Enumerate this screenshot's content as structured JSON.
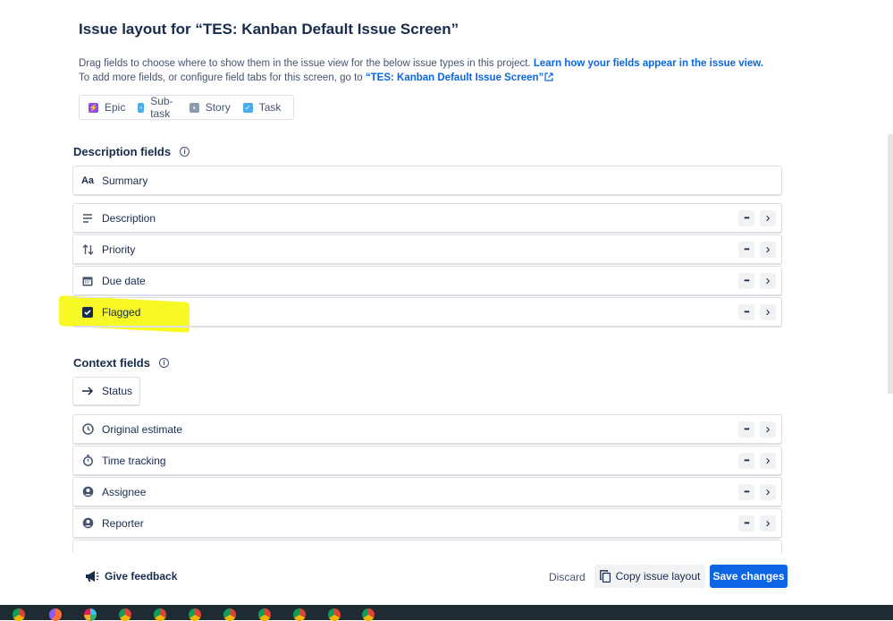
{
  "header": {
    "title": "Issue layout for “TES: Kanban Default Issue Screen”",
    "line1_text": "Drag fields to choose where to show them in the issue view for the below issue types in this project. ",
    "line1_link": "Learn how your fields appear in the issue view.",
    "line2_text": "To add more fields, or configure field tabs for this screen, go to ",
    "line2_link": "“TES: Kanban Default Issue Screen”"
  },
  "issue_types": [
    {
      "label": "Epic",
      "icon": "epic-icon",
      "color": "#904ee2"
    },
    {
      "label": "Sub-task",
      "icon": "subtask-icon",
      "color": "#4bade8"
    },
    {
      "label": "Story",
      "icon": "story-icon",
      "color": "#8c9bab"
    },
    {
      "label": "Task",
      "icon": "task-icon",
      "color": "#4bade8"
    }
  ],
  "description_fields": {
    "heading": "Description fields",
    "summary": "Summary",
    "summary_icon_text": "Aa",
    "items": [
      {
        "label": "Description",
        "icon": "text-lines-icon"
      },
      {
        "label": "Priority",
        "icon": "priority-arrows-icon"
      },
      {
        "label": "Due date",
        "icon": "calendar-icon"
      },
      {
        "label": "Flagged",
        "icon": "checkbox-icon"
      }
    ]
  },
  "context_fields": {
    "heading": "Context fields",
    "status": "Status",
    "items": [
      {
        "label": "Original estimate",
        "icon": "clock-icon"
      },
      {
        "label": "Time tracking",
        "icon": "stopwatch-icon"
      },
      {
        "label": "Assignee",
        "icon": "user-icon"
      },
      {
        "label": "Reporter",
        "icon": "user-icon"
      }
    ]
  },
  "row_actions": {
    "more": "•••",
    "expand": "›"
  },
  "footer": {
    "feedback": "Give feedback",
    "discard": "Discard",
    "copy": "Copy issue layout",
    "save": "Save changes"
  },
  "colors": {
    "accent": "#0c66e4",
    "highlight": "#f7f700"
  }
}
